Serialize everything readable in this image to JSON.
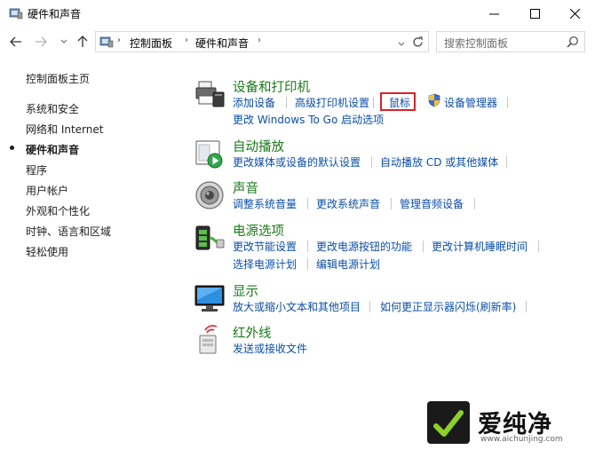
{
  "window": {
    "title": "硬件和声音"
  },
  "address_bar": {
    "breadcrumbs": [
      "控制面板",
      "硬件和声音"
    ]
  },
  "search": {
    "placeholder": "搜索控制面板"
  },
  "left_nav": {
    "items": [
      {
        "label": "控制面板主页"
      },
      {
        "label": "系统和安全"
      },
      {
        "label": "网络和 Internet"
      },
      {
        "label": "硬件和声音",
        "active": true
      },
      {
        "label": "程序"
      },
      {
        "label": "用户帐户"
      },
      {
        "label": "外观和个性化"
      },
      {
        "label": "时钟、语言和区域"
      },
      {
        "label": "轻松使用"
      }
    ]
  },
  "categories": [
    {
      "title": "设备和打印机",
      "icon": "printer-icon",
      "links": [
        "添加设备",
        "高级打印机设置",
        "鼠标",
        "设备管理器",
        "更改 Windows To Go 启动选项"
      ]
    },
    {
      "title": "自动播放",
      "icon": "autoplay-icon",
      "links": [
        "更改媒体或设备的默认设置",
        "自动播放 CD 或其他媒体"
      ]
    },
    {
      "title": "声音",
      "icon": "speaker-icon",
      "links": [
        "调整系统音量",
        "更改系统声音",
        "管理音频设备"
      ]
    },
    {
      "title": "电源选项",
      "icon": "battery-icon",
      "links": [
        "更改节能设置",
        "更改电源按钮的功能",
        "更改计算机睡眠时间",
        "选择电源计划",
        "编辑电源计划"
      ]
    },
    {
      "title": "显示",
      "icon": "monitor-icon",
      "links": [
        "放大或缩小文本和其他项目",
        "如何更正显示器闪烁(刷新率)"
      ]
    },
    {
      "title": "红外线",
      "icon": "infrared-icon",
      "links": [
        "发送或接收文件"
      ]
    }
  ],
  "watermark": {
    "brand": "爱纯净",
    "url": "www.aichunjing.com"
  },
  "colors": {
    "category_title": "#1a7a1a",
    "link": "#0b4ea8",
    "highlight_box": "#d4242a"
  }
}
